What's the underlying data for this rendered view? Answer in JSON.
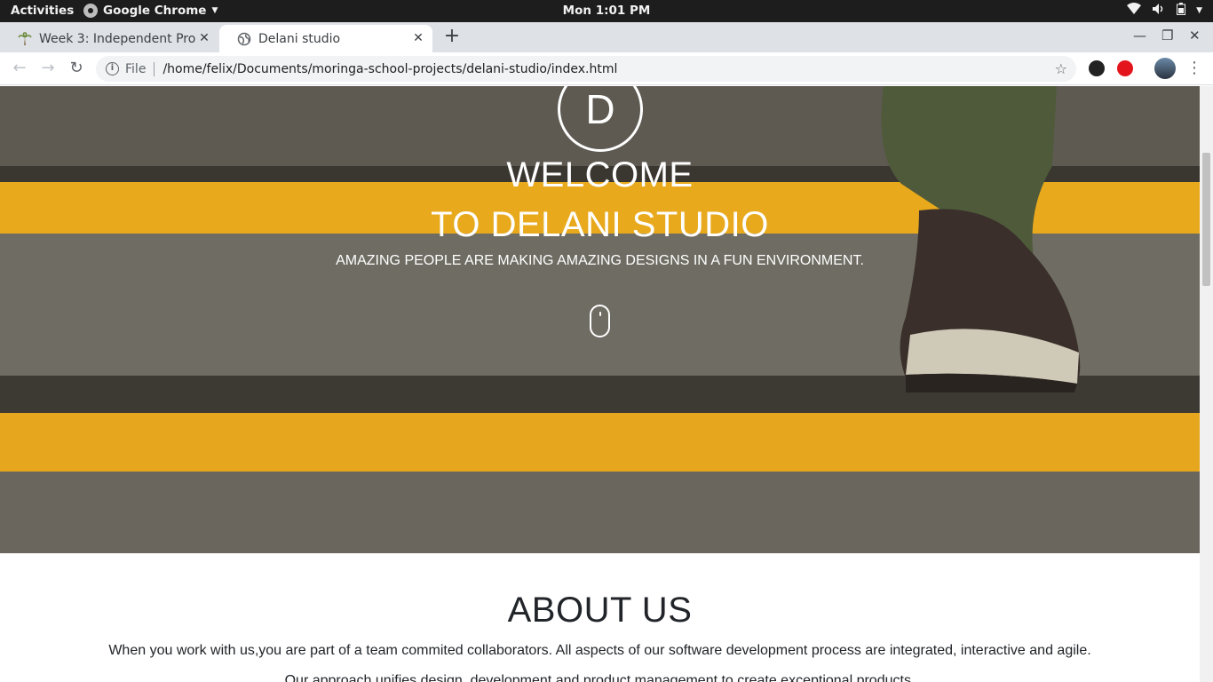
{
  "system_bar": {
    "activities": "Activities",
    "app_name": "Google Chrome",
    "clock": "Mon  1:01 PM"
  },
  "tabs": [
    {
      "title": "Week 3: Independent Proj",
      "active": false
    },
    {
      "title": "Delani studio",
      "active": true
    }
  ],
  "omnibox": {
    "scheme_label": "File",
    "url": "/home/felix/Documents/moringa-school-projects/delani-studio/index.html"
  },
  "hero": {
    "logo_letter": "D",
    "heading_line1": "WELCOME",
    "heading_line2": "TO DELANI STUDIO",
    "tagline": "AMAZING PEOPLE ARE MAKING AMAZING DESIGNS IN A FUN ENVIRONMENT."
  },
  "about": {
    "heading": "ABOUT US",
    "paragraph1": "When you work with us,you are part of a team commited collaborators. All aspects of our software development process are integrated, interactive and agile.",
    "paragraph2": "Our approach unifies design, development and product management to create exceptional products."
  },
  "colors": {
    "stripe_yellow": "#e8a91c",
    "step_gray": "#6e6b62",
    "chrome_tabstrip": "#dee1e6"
  }
}
